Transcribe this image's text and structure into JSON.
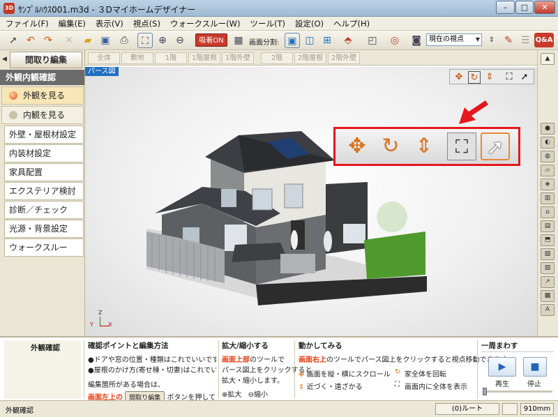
{
  "window": {
    "icon_text": "3D",
    "title": "ｻﾝﾌﾟﾙﾊｳｽ001.m3d - ３Dマイホームデザイナー",
    "min_label": "–",
    "max_label": "□",
    "close_label": "✕"
  },
  "menubar": {
    "items": [
      "ファイル(F)",
      "編集(E)",
      "表示(V)",
      "視点(S)",
      "ウォークスルー(W)",
      "ツール(T)",
      "設定(O)",
      "ヘルプ(H)"
    ]
  },
  "toolbar": {
    "kyuchaku_label": "吸着ON",
    "split_label": "画面分割:",
    "viewpoint_value": "現在の視点",
    "qa_label": "Q&A",
    "icons": [
      "select-icon",
      "undo-icon",
      "redo-icon",
      "delete-icon",
      "open-icon",
      "save-icon",
      "print-icon",
      "fit-icon",
      "zoom-in-icon",
      "zoom-out-icon"
    ]
  },
  "left_panel": {
    "edit_mode_tab": "間取り編集",
    "section_header": "外観内観確認",
    "view_exterior": "外観を見る",
    "view_interior": "内観を見る",
    "menu_items": [
      "外壁・屋根材設定",
      "内装材設定",
      "家具配置",
      "エクステリア検討",
      "診断／チェック",
      "光源・背景設定",
      "ウォークスルー"
    ]
  },
  "floor_tabs": [
    "全体",
    "敷地",
    "1階",
    "1階屋根",
    "1階外壁",
    "2階",
    "2階屋根",
    "2階外壁"
  ],
  "viewport": {
    "perspective_label": "パース図",
    "axis_z": "Z",
    "axis_y": "Y",
    "axis_x": "X"
  },
  "bottom": {
    "title": "外観確認",
    "col1_head": "確認ポイントと編集方法",
    "col1_line1": "●ドアや窓の位置・種類はこれでいいですか。",
    "col1_line2": "●屋根のかけ方(寄せ棟・切妻)はこれでいいですか。",
    "col1_line3": "編集箇所がある場合は、",
    "col1_red": "画面左上の",
    "col1_btn": "間取り編集",
    "col1_tail": "ボタンを押して",
    "col2_head": "拡大/縮小する",
    "col2_red": "画面上部",
    "col2_line1": "のツールで",
    "col2_line2": "パース図上をクリックすると",
    "col2_line3": "拡大・縮小します。",
    "col2_zoom_in": "拡大",
    "col2_zoom_out": "縮小",
    "col3_head": "動かしてみる",
    "col3_red": "画面右上",
    "col3_line1": "のツールでパース図上をクリックすると視点移動できます。",
    "col3_scroll": "画面を縦・横にスクロール",
    "col3_rotate": "家全体を回転",
    "col3_near": "近づく・遠ざかる",
    "col3_fit": "画面内に全体を表示",
    "col4_head": "一周まわす",
    "play_label": "再生",
    "stop_label": "停止"
  },
  "status": {
    "text": "外観確認",
    "route": "(0)ルート",
    "size": "910mm"
  }
}
